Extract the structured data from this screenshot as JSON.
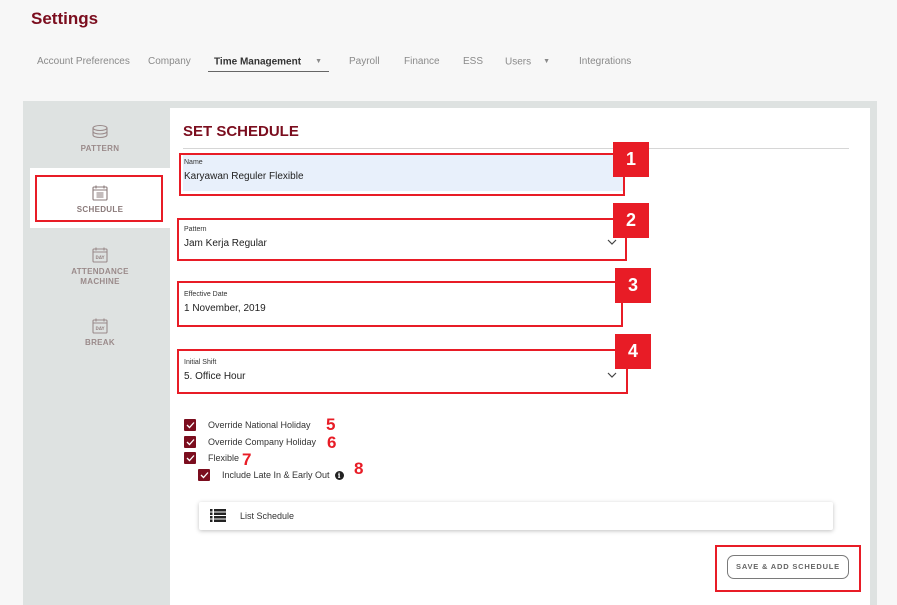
{
  "page": {
    "title": "Settings"
  },
  "top_nav": [
    {
      "label": "Account Preferences",
      "active": false,
      "has_dropdown": false
    },
    {
      "label": "Company",
      "active": false,
      "has_dropdown": false
    },
    {
      "label": "Time Management",
      "active": true,
      "has_dropdown": true
    },
    {
      "label": "Payroll",
      "active": false,
      "has_dropdown": false
    },
    {
      "label": "Finance",
      "active": false,
      "has_dropdown": false
    },
    {
      "label": "ESS",
      "active": false,
      "has_dropdown": false
    },
    {
      "label": "Users",
      "active": false,
      "has_dropdown": true
    },
    {
      "label": "Integrations",
      "active": false,
      "has_dropdown": false
    }
  ],
  "sidebar": {
    "items": [
      {
        "label": "PATTERN",
        "icon": "layers-icon",
        "active": false
      },
      {
        "label": "SCHEDULE",
        "icon": "calendar-list-icon",
        "active": true
      },
      {
        "label": "ATTENDANCE MACHINE",
        "icon": "calendar-day-icon",
        "active": false,
        "icon_text": "DAY"
      },
      {
        "label": "BREAK",
        "icon": "calendar-day-icon",
        "active": false,
        "icon_text": "DAY"
      }
    ]
  },
  "form": {
    "title": "SET SCHEDULE",
    "name": {
      "label": "Name",
      "value": "Karyawan Reguler Flexible"
    },
    "pattern": {
      "label": "Pattern",
      "value": "Jam Kerja Regular"
    },
    "effective_date": {
      "label": "Effective Date",
      "value": "1 November, 2019"
    },
    "initial_shift": {
      "label": "Initial Shift",
      "value": "5. Office Hour"
    },
    "checkboxes": [
      {
        "label": "Override National Holiday",
        "checked": true
      },
      {
        "label": "Override Company Holiday",
        "checked": true
      },
      {
        "label": "Flexible",
        "checked": true
      },
      {
        "label": "Include Late In & Early Out",
        "checked": true,
        "has_info": true
      }
    ],
    "info_glyph": "i",
    "list_schedule_label": "List Schedule",
    "save_button_label": "SAVE & ADD SCHEDULE"
  },
  "annotations": {
    "color": "#e81c26",
    "markers": [
      "1",
      "2",
      "3",
      "4",
      "5",
      "6",
      "7",
      "8"
    ]
  },
  "colors": {
    "brand": "#7b0d1e",
    "panel_bg": "#dee2e1",
    "page_bg": "#f7f7f7",
    "input_fill": "#e8f0fb"
  }
}
